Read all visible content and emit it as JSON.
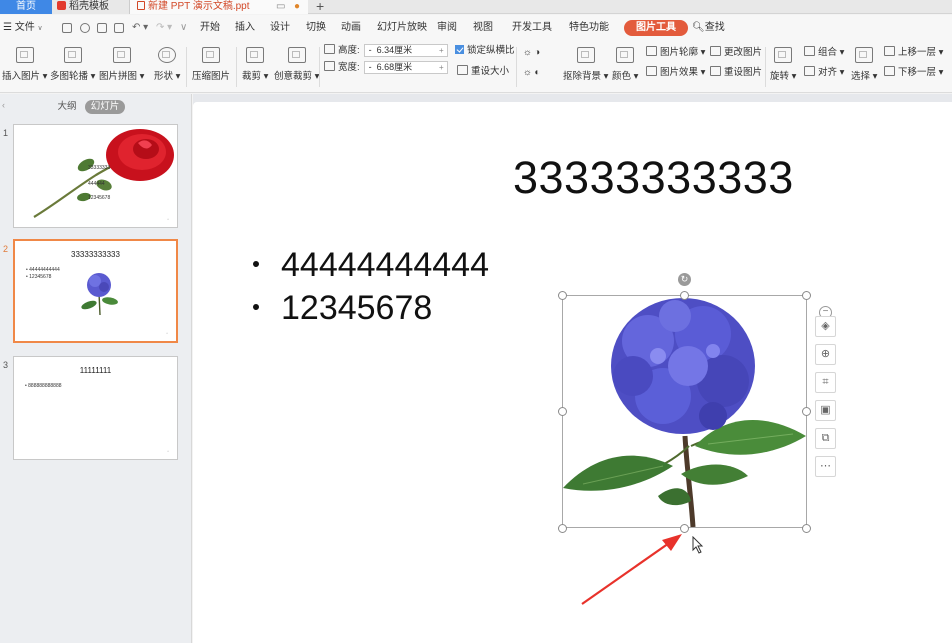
{
  "tabbar": {
    "home": "首页",
    "templates": "稻壳模板",
    "document": "新建 PPT 演示文稿.ppt",
    "add": "+"
  },
  "menubar": {
    "file": "文件",
    "items": [
      "开始",
      "插入",
      "设计",
      "切换",
      "动画",
      "幻灯片放映",
      "审阅",
      "视图",
      "开发工具",
      "特色功能"
    ],
    "active_tab": "图片工具",
    "search": "查找"
  },
  "ribbon": {
    "insert_picture": "插入图片",
    "multi_outline": "多图轮播",
    "picture_collage": "图片拼图",
    "shape": "形状",
    "compress": "压缩图片",
    "crop": "裁剪",
    "creative_crop": "创意裁剪",
    "height_label": "高度:",
    "height_value": "6.34厘米",
    "width_label": "宽度:",
    "width_value": "6.68厘米",
    "lock_ratio": "锁定纵横比",
    "reset_size": "重设大小",
    "remove_bg": "抠除背景",
    "color": "颜色",
    "pic_outline": "图片轮廓",
    "pic_effect": "图片效果",
    "change_pic": "更改图片",
    "reset_pic": "重设图片",
    "rotate": "旋转",
    "group": "组合",
    "align": "对齐",
    "select": "选择",
    "bring_forward": "上移一层",
    "send_backward": "下移一层"
  },
  "panel": {
    "outline_tab": "大纲",
    "slides_tab": "幻灯片",
    "slides": [
      {
        "num": "1",
        "lines": [
          "33333333",
          "444444",
          "12345678"
        ]
      },
      {
        "num": "2",
        "title": "33333333333",
        "lines": [
          "• 44444444444",
          "• 12345678"
        ]
      },
      {
        "num": "3",
        "title": "11111111",
        "lines": [
          "• 888888888888"
        ]
      }
    ]
  },
  "slide": {
    "title": "33333333333",
    "bullets": [
      "44444444444",
      "12345678"
    ]
  },
  "colors": {
    "accent": "#e35b3c",
    "selected_thumb": "#f08847",
    "home_tab": "#3f88e6",
    "annotation_arrow": "#e8322b"
  }
}
